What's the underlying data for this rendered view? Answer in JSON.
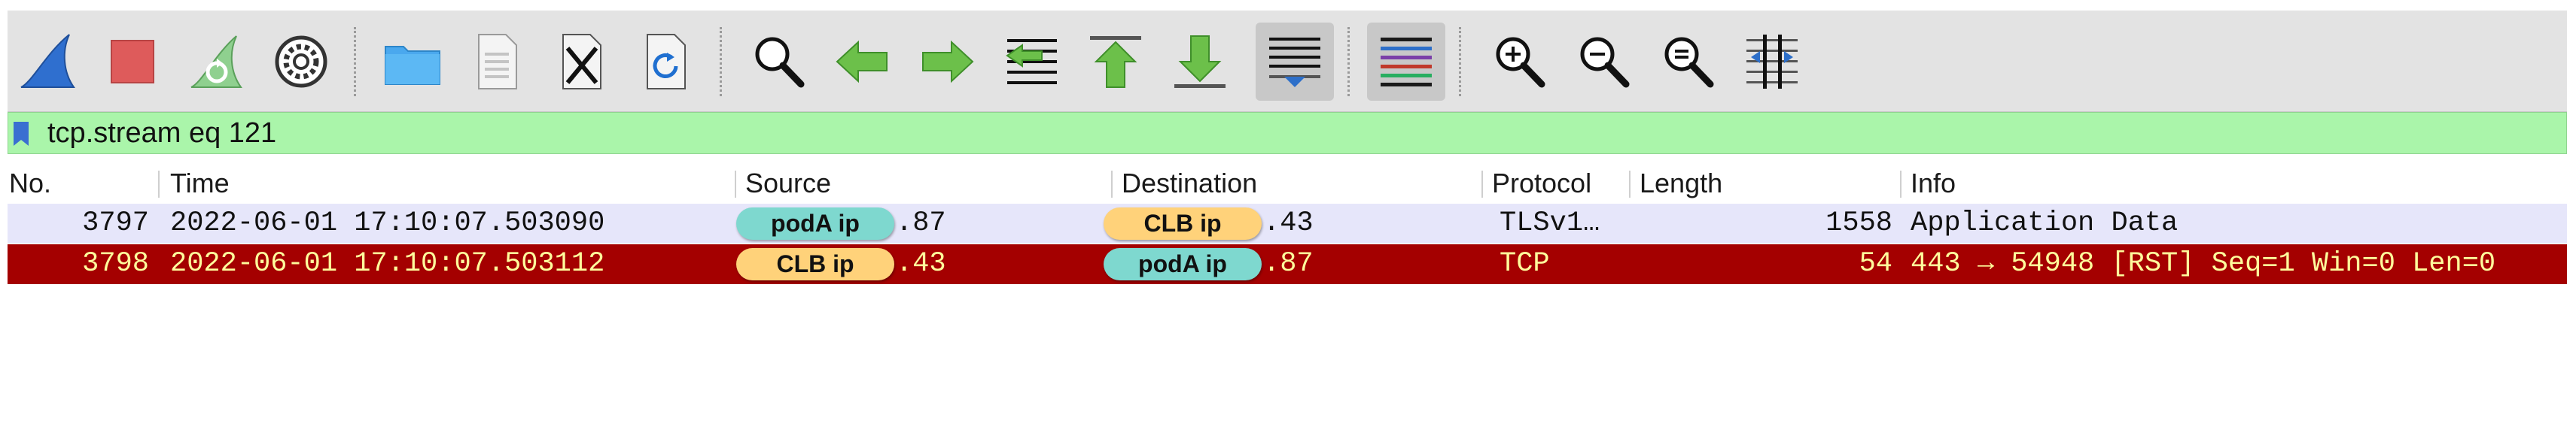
{
  "toolbar": {
    "buttons": [
      {
        "id": "start-capture",
        "icon": "shark-fin-icon"
      },
      {
        "id": "stop-capture",
        "icon": "stop-square-icon"
      },
      {
        "id": "restart-capture",
        "icon": "restart-fin-icon"
      },
      {
        "id": "capture-options",
        "icon": "gear-icon"
      },
      {
        "id": "open-file",
        "icon": "folder-icon"
      },
      {
        "id": "save-file",
        "icon": "binary-file-icon"
      },
      {
        "id": "close-file",
        "icon": "close-file-icon"
      },
      {
        "id": "reload-file",
        "icon": "reload-file-icon"
      },
      {
        "id": "find-packet",
        "icon": "magnifier-icon"
      },
      {
        "id": "go-back",
        "icon": "arrow-left-icon"
      },
      {
        "id": "go-forward",
        "icon": "arrow-right-icon"
      },
      {
        "id": "go-to-packet",
        "icon": "goto-packet-icon"
      },
      {
        "id": "go-first",
        "icon": "arrow-up-first-icon"
      },
      {
        "id": "go-last",
        "icon": "arrow-down-last-icon"
      },
      {
        "id": "auto-scroll",
        "icon": "autoscroll-icon",
        "active": true
      },
      {
        "id": "colorize",
        "icon": "colorize-lines-icon",
        "active": true
      },
      {
        "id": "zoom-in",
        "icon": "zoom-in-icon"
      },
      {
        "id": "zoom-out",
        "icon": "zoom-out-icon"
      },
      {
        "id": "zoom-normal",
        "icon": "zoom-normal-icon"
      },
      {
        "id": "resize-columns",
        "icon": "resize-columns-icon"
      }
    ]
  },
  "filter": {
    "value": "tcp.stream eq 121",
    "background": "#aaf5aa"
  },
  "columns": {
    "no": "No.",
    "time": "Time",
    "source": "Source",
    "destination": "Destination",
    "protocol": "Protocol",
    "length": "Length",
    "info": "Info"
  },
  "packets": [
    {
      "no": "3797",
      "time": "2022-06-01 17:10:07.503090",
      "source_tag": "podA ip",
      "source_suffix": ".87",
      "destination_tag": "CLB ip",
      "destination_suffix": ".43",
      "protocol": "TLSv1…",
      "length": "1558",
      "info": "Application Data",
      "row_color": "#e6e6fa",
      "text_color": "#111111"
    },
    {
      "no": "3798",
      "time": "2022-06-01 17:10:07.503112",
      "source_tag": "CLB ip",
      "source_suffix": ".43",
      "destination_tag": "podA ip",
      "destination_suffix": ".87",
      "protocol": "TCP",
      "length": "54",
      "info": "443 → 54948 [RST] Seq=1 Win=0 Len=0",
      "row_color": "#a40000",
      "text_color": "#fffc9c"
    }
  ],
  "colors": {
    "pill_teal": "#7ed8cf",
    "pill_orange": "#ffd27a",
    "toolbar_bg": "#e3e3e3"
  }
}
